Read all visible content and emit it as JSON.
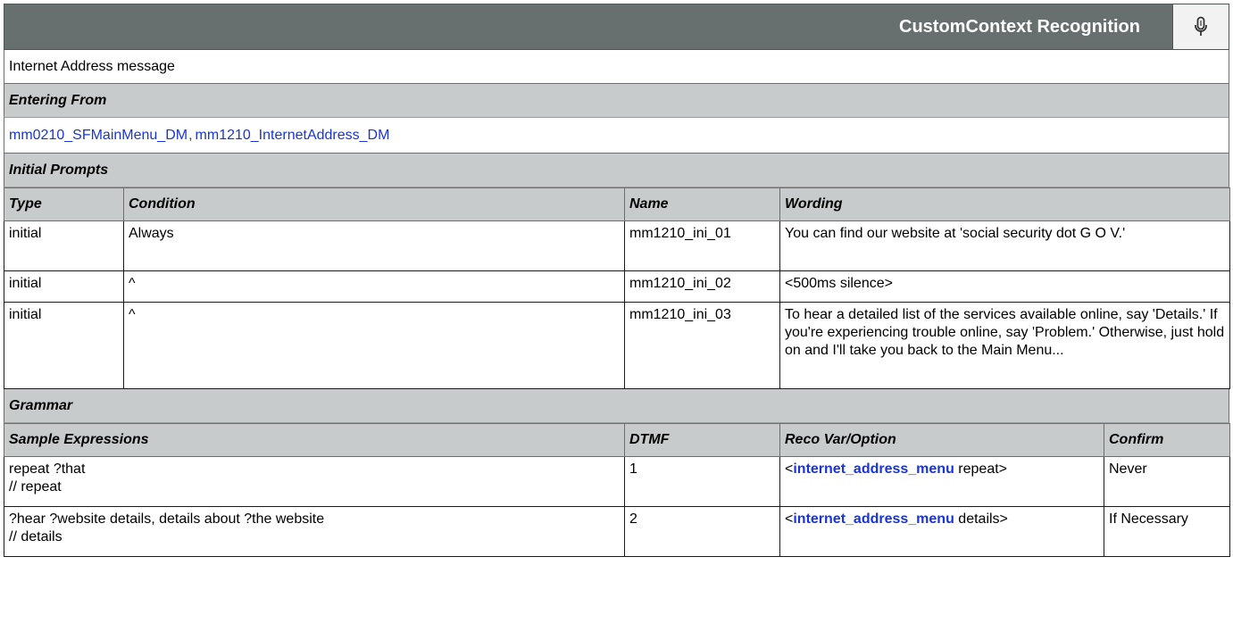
{
  "header": {
    "title": "CustomContext Recognition",
    "icon": "microphone-icon"
  },
  "description": "Internet Address message",
  "entering_from": {
    "heading": "Entering From",
    "links": [
      "mm0210_SFMainMenu_DM",
      "mm1210_InternetAddress_DM"
    ],
    "separator": ","
  },
  "initial_prompts": {
    "heading": "Initial Prompts",
    "columns": [
      "Type",
      "Condition",
      "Name",
      "Wording"
    ],
    "rows": [
      {
        "type": "initial",
        "condition": "Always",
        "name": "mm1210_ini_01",
        "wording": "You can find our website at 'social security dot G O V.'"
      },
      {
        "type": "initial",
        "condition": "^",
        "name": "mm1210_ini_02",
        "wording": "<500ms silence>"
      },
      {
        "type": "initial",
        "condition": "^",
        "name": "mm1210_ini_03",
        "wording": "To hear a detailed list of the services available online, say 'Details.'  If you're experiencing trouble online, say 'Problem.'  Otherwise, just hold on and I'll take you back to the Main Menu..."
      }
    ]
  },
  "grammar": {
    "heading": "Grammar",
    "columns": [
      "Sample Expressions",
      "DTMF",
      "Reco Var/Option",
      "Confirm"
    ],
    "rows": [
      {
        "expr_line1": "repeat ?that",
        "expr_line2": "// repeat",
        "dtmf": "1",
        "reco_open": "<",
        "reco_var": "internet_address_menu",
        "reco_option": " repeat>",
        "confirm": "Never"
      },
      {
        "expr_line1": "?hear ?website details, details about ?the website",
        "expr_line2": "// details",
        "dtmf": "2",
        "reco_open": "<",
        "reco_var": "internet_address_menu",
        "reco_option": " details>",
        "confirm": "If Necessary"
      }
    ]
  }
}
